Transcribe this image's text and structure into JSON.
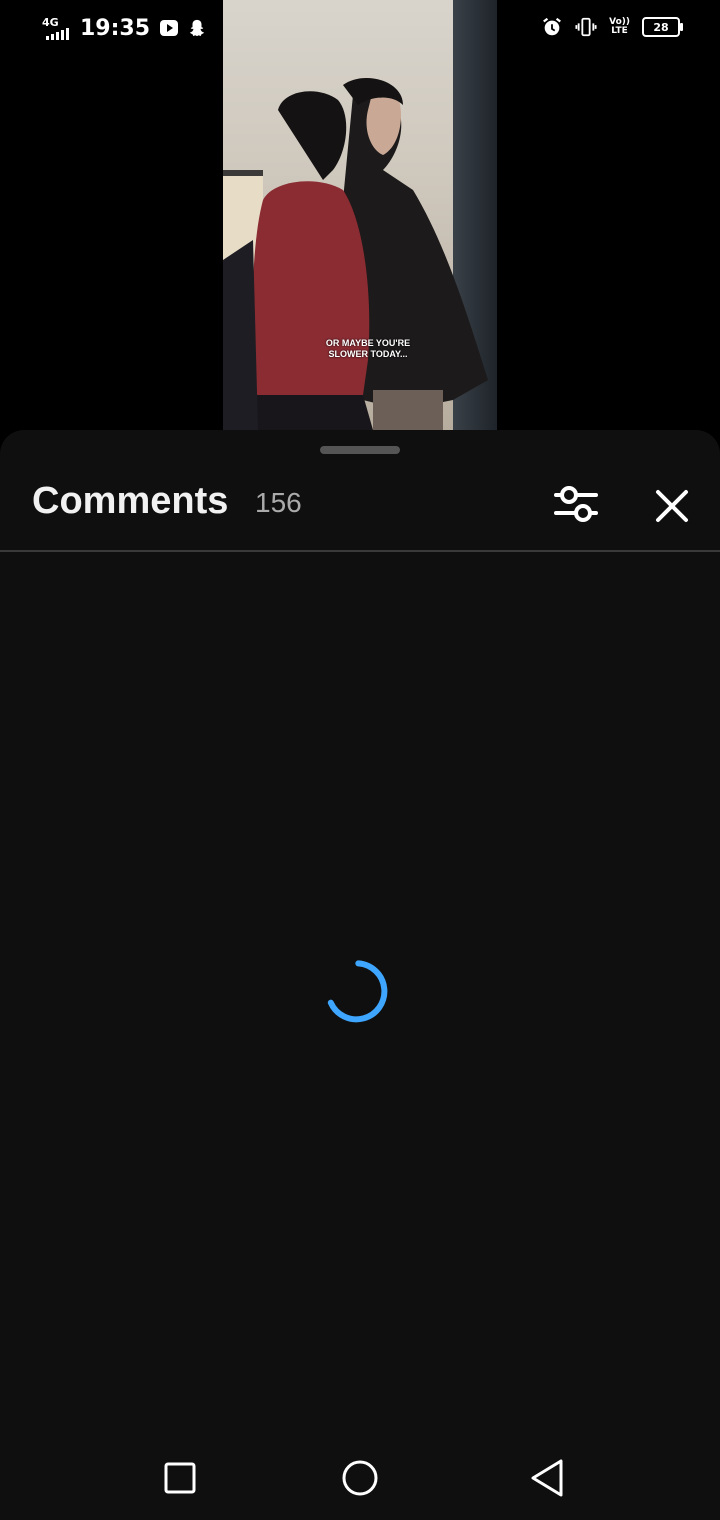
{
  "status_bar": {
    "network": "4G",
    "time": "19:35",
    "volte_line1": "Vo))",
    "volte_line2": "LTE",
    "battery": "28",
    "icons": [
      "signal-icon",
      "youtube-icon",
      "snapchat-icon",
      "alarm-icon",
      "vibrate-icon",
      "volte-icon",
      "battery-icon"
    ]
  },
  "video": {
    "subtitle_line1": "OR MAYBE YOU'RE",
    "subtitle_line2": "SLOWER TODAY..."
  },
  "comments": {
    "title": "Comments",
    "count": "156",
    "loading": true
  },
  "colors": {
    "sheet_bg": "#0f0f0f",
    "spinner": "#3ea6ff",
    "divider": "#3a3a3a",
    "count_text": "#aaaaaa"
  },
  "nav": {
    "icons": [
      "recents-icon",
      "home-icon",
      "back-icon"
    ]
  }
}
